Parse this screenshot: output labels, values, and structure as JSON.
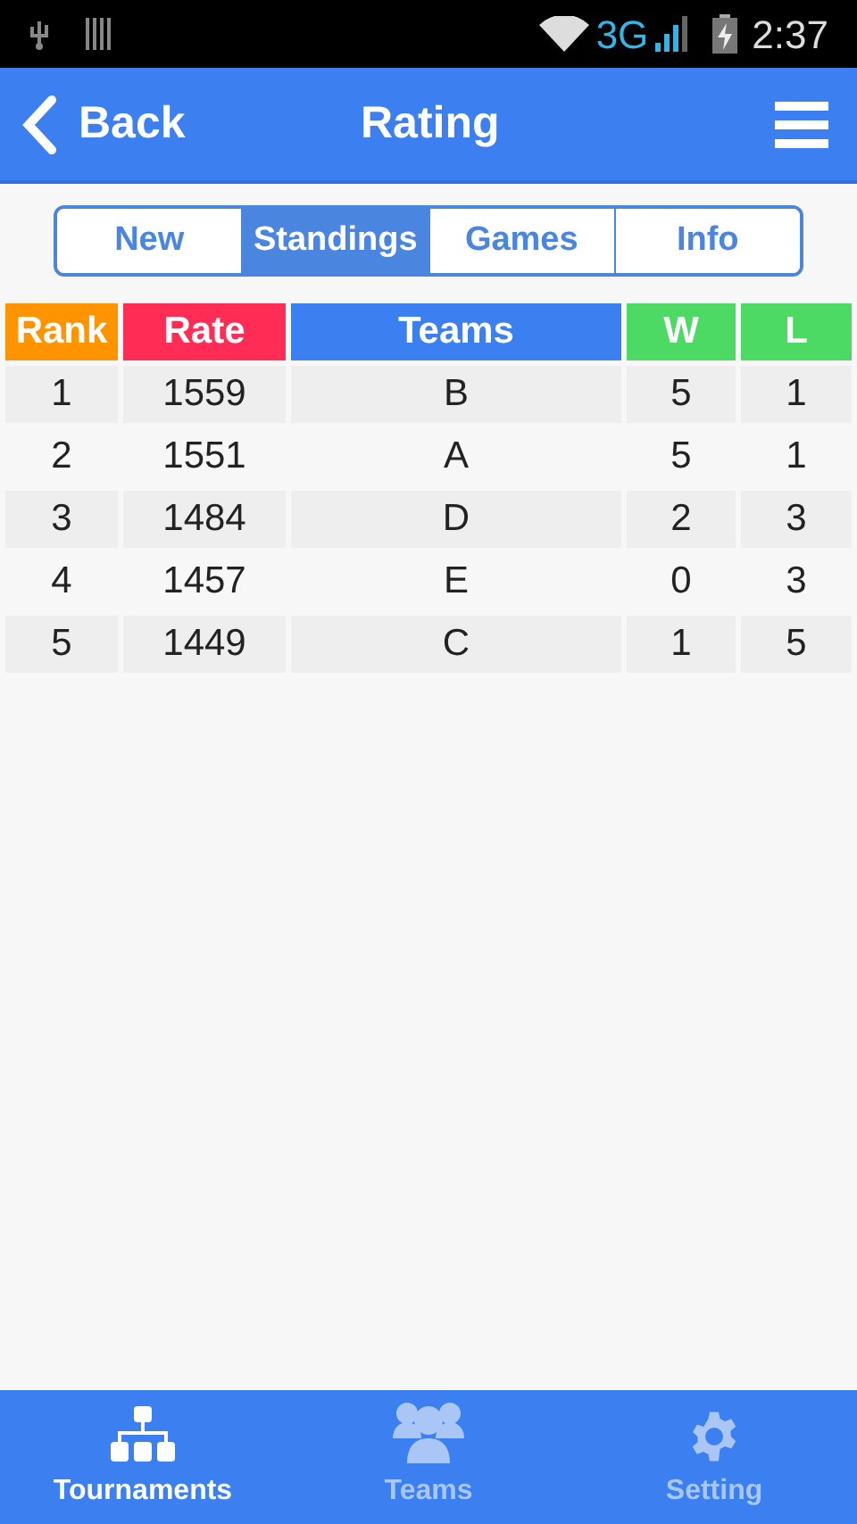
{
  "status_bar": {
    "network": "3G",
    "time": "2:37"
  },
  "header": {
    "back": "Back",
    "title": "Rating"
  },
  "tabs": [
    {
      "label": "New",
      "selected": false
    },
    {
      "label": "Standings",
      "selected": true
    },
    {
      "label": "Games",
      "selected": false
    },
    {
      "label": "Info",
      "selected": false
    }
  ],
  "table": {
    "columns": [
      {
        "label": "Rank",
        "color": "#ff9400"
      },
      {
        "label": "Rate",
        "color": "#ff2d55"
      },
      {
        "label": "Teams",
        "color": "#3b7ff0"
      },
      {
        "label": "W",
        "color": "#4cd964"
      },
      {
        "label": "L",
        "color": "#4cd964"
      }
    ],
    "rows": [
      [
        "1",
        "1559",
        "B",
        "5",
        "1"
      ],
      [
        "2",
        "1551",
        "A",
        "5",
        "1"
      ],
      [
        "3",
        "1484",
        "D",
        "2",
        "3"
      ],
      [
        "4",
        "1457",
        "E",
        "0",
        "3"
      ],
      [
        "5",
        "1449",
        "C",
        "1",
        "5"
      ]
    ]
  },
  "bottom_nav": [
    {
      "label": "Tournaments",
      "kind": "tree",
      "selected": true
    },
    {
      "label": "Teams",
      "kind": "people",
      "selected": false
    },
    {
      "label": "Setting",
      "kind": "gear",
      "selected": false
    }
  ]
}
